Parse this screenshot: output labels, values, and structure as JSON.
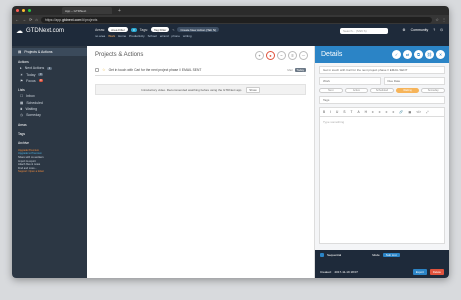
{
  "browser": {
    "tab_title": "App – GTDNext",
    "url_prefix": "https://app.",
    "url_host": "gtdnext.com",
    "url_path": "/#/projects"
  },
  "topbar": {
    "logo": "GTDNext.com",
    "areas_label": "Areas:",
    "areas_filter": "Area Filter",
    "areas_count": "0",
    "tags_label": "Tags:",
    "tags_filter": "Tag Filter",
    "create_action": "Create New Action (Tab N)",
    "crumbs": [
      "no area",
      "Work",
      "Home",
      "Productivity",
      "School",
      "errand",
      "phone",
      "writing"
    ],
    "search_placeholder": "Search... (Shift S)",
    "community": "Community",
    "help": "?"
  },
  "sidebar": {
    "selected": "Projects & Actions",
    "actions_header": "Actions",
    "actions": [
      {
        "label": "Next Actions",
        "count": "1"
      },
      {
        "label": "Today",
        "count": "0"
      },
      {
        "label": "Focus",
        "count": "0"
      }
    ],
    "lists_header": "Lists",
    "lists": [
      "Inbox",
      "Scheduled",
      "Waiting",
      "Someday"
    ],
    "misc": [
      "Areas",
      "Tags",
      "Archive"
    ],
    "promo_title": "Upgrade Premium",
    "promo_lines": [
      "Upgrade to Premium",
      "Share with co-workers",
      "Import & export",
      "Attach files & notes",
      "Find and more...",
      "Support: Open a ticket"
    ]
  },
  "main": {
    "title": "Projects & Actions",
    "task_text": "Get in touch with Carl for the next project phase // EMAIL SENT",
    "task_tag": "Mail",
    "task_chip": "Today",
    "banner_text": "Introductory video. Recommended watching before using the GTDNext app.",
    "banner_show": "Show"
  },
  "details": {
    "title": "Details",
    "name_value": "Get in touch with Carl for the next project phase // EMAIL SENT",
    "area_value": "Work",
    "due_date_placeholder": "Due Date",
    "tags_placeholder": "Tags",
    "statuses": [
      "Next",
      "Active",
      "Scheduled",
      "Waiting",
      "Someday"
    ],
    "active_status": "Waiting",
    "editor_tools": [
      "B",
      "I",
      "U",
      "S",
      "T",
      "A",
      "H",
      "≡",
      "≡",
      "≡",
      "≡",
      "🔗",
      "▦",
      "</>",
      "⤢"
    ],
    "editor_placeholder": "Type something",
    "sequential_label": "Sequential",
    "mode_label": "Mode",
    "mode_value": "Sub List",
    "created_label": "Created:",
    "created_value": "2017-11-19 18:07",
    "export_btn": "Export",
    "delete_btn": "Delete"
  },
  "colors": {
    "brand_dark": "#1e2a3a",
    "accent_blue": "#2b84c6",
    "status_orange": "#f6b45a",
    "danger": "#e0533d"
  }
}
